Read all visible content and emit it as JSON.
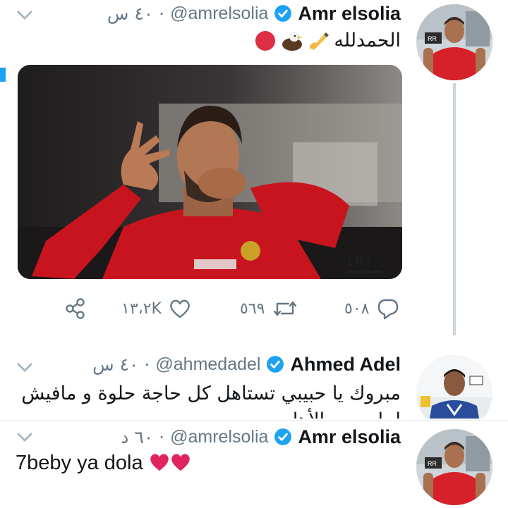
{
  "tweets": [
    {
      "name": "Amr elsolia",
      "handle": "@amrelsolia",
      "separator": "·",
      "time": "٤٠ س",
      "text": "الحمدلله",
      "emojis": [
        "writing-hand",
        "eagle",
        "red-circle"
      ],
      "actions": {
        "reply_count": "٥٠٨",
        "retweet_count": "٥٦٩",
        "like_count": "١٣،٢K"
      },
      "media": {
        "watermark": "Ola",
        "watermark_sub": "PHOTOGRAPHY"
      }
    },
    {
      "name": "Ahmed Adel",
      "handle": "@ahmedadel",
      "separator": "·",
      "time": "٤٠ س",
      "text": "مبروك يا حبيبي تستاهل كل حاجة حلوة و مافيش احلى من الأهلي"
    },
    {
      "name": "Amr elsolia",
      "handle": "@amrelsolia",
      "separator": "·",
      "time": "٦٠ د",
      "text": "7beby ya dola"
    }
  ],
  "colors": {
    "accent": "#1da1f2",
    "muted": "#657786",
    "jersey_red": "#d6202a",
    "heart": "#e0245e"
  }
}
